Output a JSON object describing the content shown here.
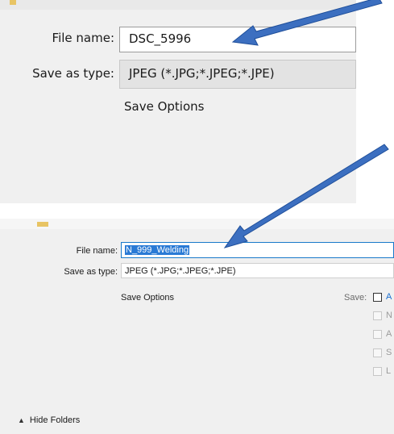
{
  "top_dialog": {
    "file_name_label": "File name:",
    "file_name_value": "DSC_5996",
    "save_as_type_label": "Save as type:",
    "save_as_type_value": "JPEG (*.JPG;*.JPEG;*.JPE)",
    "save_options_label": "Save Options"
  },
  "bottom_dialog": {
    "file_name_label": "File name:",
    "file_name_value": "N_999_Welding",
    "save_as_type_label": "Save as type:",
    "save_as_type_value": "JPEG (*.JPG;*.JPEG;*.JPE)",
    "save_options_label": "Save Options",
    "save_label": "Save:",
    "checkbox_letters": [
      "A",
      "N",
      "A",
      "S",
      "L"
    ],
    "hide_folders_label": "Hide Folders"
  },
  "colors": {
    "arrow": "#3c6fc0",
    "selection": "#2a7ad5",
    "dialog_bg": "#f0f0f0"
  }
}
